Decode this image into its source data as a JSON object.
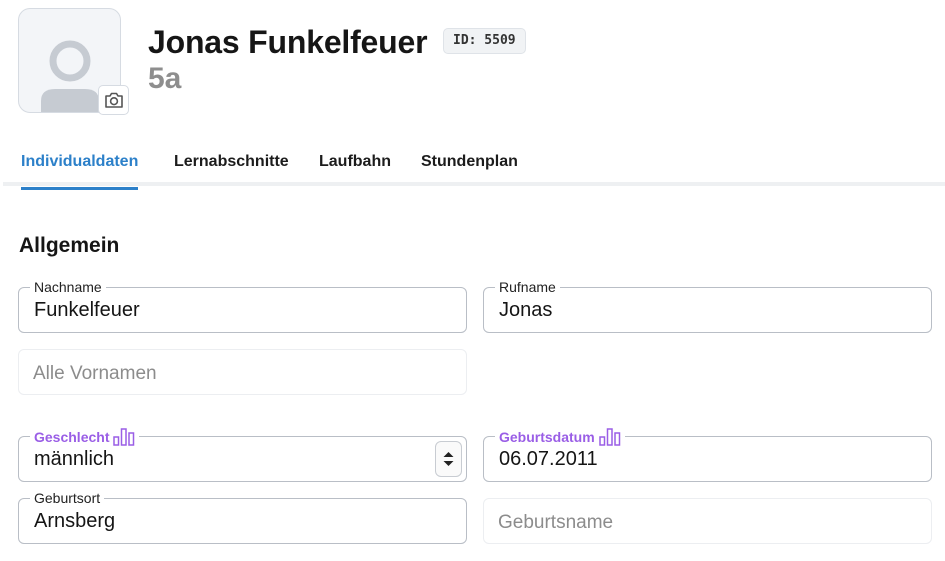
{
  "header": {
    "name": "Jonas Funkelfeuer",
    "id_badge": "ID: 5509",
    "klasse": "5a",
    "avatar_icon": "person-placeholder-icon",
    "camera_icon": "camera-icon"
  },
  "tabs": [
    {
      "label": "Individualdaten",
      "active": true
    },
    {
      "label": "Lernabschnitte",
      "active": false
    },
    {
      "label": "Laufbahn",
      "active": false
    },
    {
      "label": "Stundenplan",
      "active": false
    }
  ],
  "section": {
    "title": "Allgemein"
  },
  "fields": {
    "nachname": {
      "label": "Nachname",
      "value": "Funkelfeuer"
    },
    "rufname": {
      "label": "Rufname",
      "value": "Jonas"
    },
    "vornamen": {
      "placeholder": "Alle Vornamen"
    },
    "geschlecht": {
      "label": "Geschlecht",
      "value": "männlich",
      "icon": "statistics-bar-icon"
    },
    "geburtsdatum": {
      "label": "Geburtsdatum",
      "value": "06.07.2011",
      "icon": "statistics-bar-icon"
    },
    "geburtsort": {
      "label": "Geburtsort",
      "value": "Arnsberg"
    },
    "geburtsname": {
      "placeholder": "Geburtsname"
    }
  },
  "colors": {
    "accent": "#2c80c9",
    "statistics_label": "#9a5ee6",
    "muted": "#8e8e8e"
  }
}
